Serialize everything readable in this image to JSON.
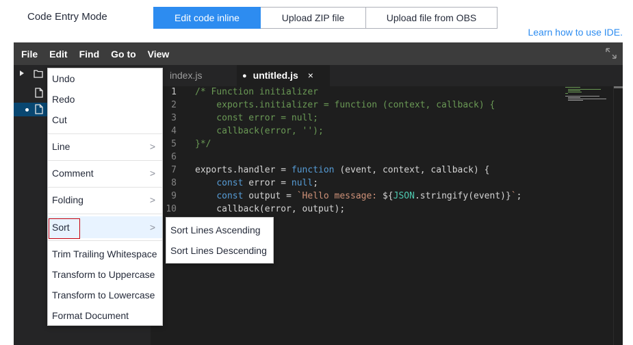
{
  "header": {
    "mode_label": "Code Entry Mode",
    "tabs": [
      "Edit code inline",
      "Upload ZIP file",
      "Upload file from OBS"
    ],
    "active_tab": "Edit code inline",
    "learn_link": "Learn how to use IDE."
  },
  "menubar": {
    "items": [
      "File",
      "Edit",
      "Find",
      "Go to",
      "View"
    ]
  },
  "editor_tabs": {
    "tab1": "index.js",
    "tab2": "untitled.js",
    "close_glyph": "×",
    "modified_glyph": "●"
  },
  "code": {
    "line_numbers": [
      "1",
      "2",
      "3",
      "4",
      "5",
      "6",
      "7",
      "8",
      "9",
      "10"
    ],
    "l1": "/* Function initializer",
    "l2": "    exports.initializer = function (context, callback) {",
    "l3": "    const error = null;",
    "l4": "    callback(error, '');",
    "l5": "}*/",
    "l7_kw": "function",
    "l7_a": "exports.handler = ",
    "l7_b": " (event, context, callback) {",
    "l8_kw": "const",
    "l8_a": "    ",
    "l8_b": " error = ",
    "l8_null": "null",
    "l8_c": ";",
    "l9_a": "    ",
    "l9_kw": "const",
    "l9_b": " output = ",
    "l9_str": "`Hello message: ",
    "l9_c": "${",
    "l9_json": "JSON",
    "l9_d": ".stringify(event)}",
    "l9_str2": "`",
    "l9_e": ";",
    "l10": "    callback(error, output);"
  },
  "context_menu": {
    "undo": "Undo",
    "redo": "Redo",
    "cut": "Cut",
    "line": "Line",
    "comment": "Comment",
    "folding": "Folding",
    "sort": "Sort",
    "trim": "Trim Trailing Whitespace",
    "upper": "Transform to Uppercase",
    "lower": "Transform to Lowercase",
    "format": "Format Document",
    "chevron": ">"
  },
  "sort_submenu": {
    "asc": "Sort Lines Ascending",
    "desc": "Sort Lines Descending"
  },
  "colors": {
    "accent": "#2d8cf0",
    "menubar": "#3c3c3c",
    "editor_bg": "#1e1e1e",
    "sidebar_bg": "#252526",
    "selection": "#094771",
    "highlight_border": "#c7000b"
  }
}
